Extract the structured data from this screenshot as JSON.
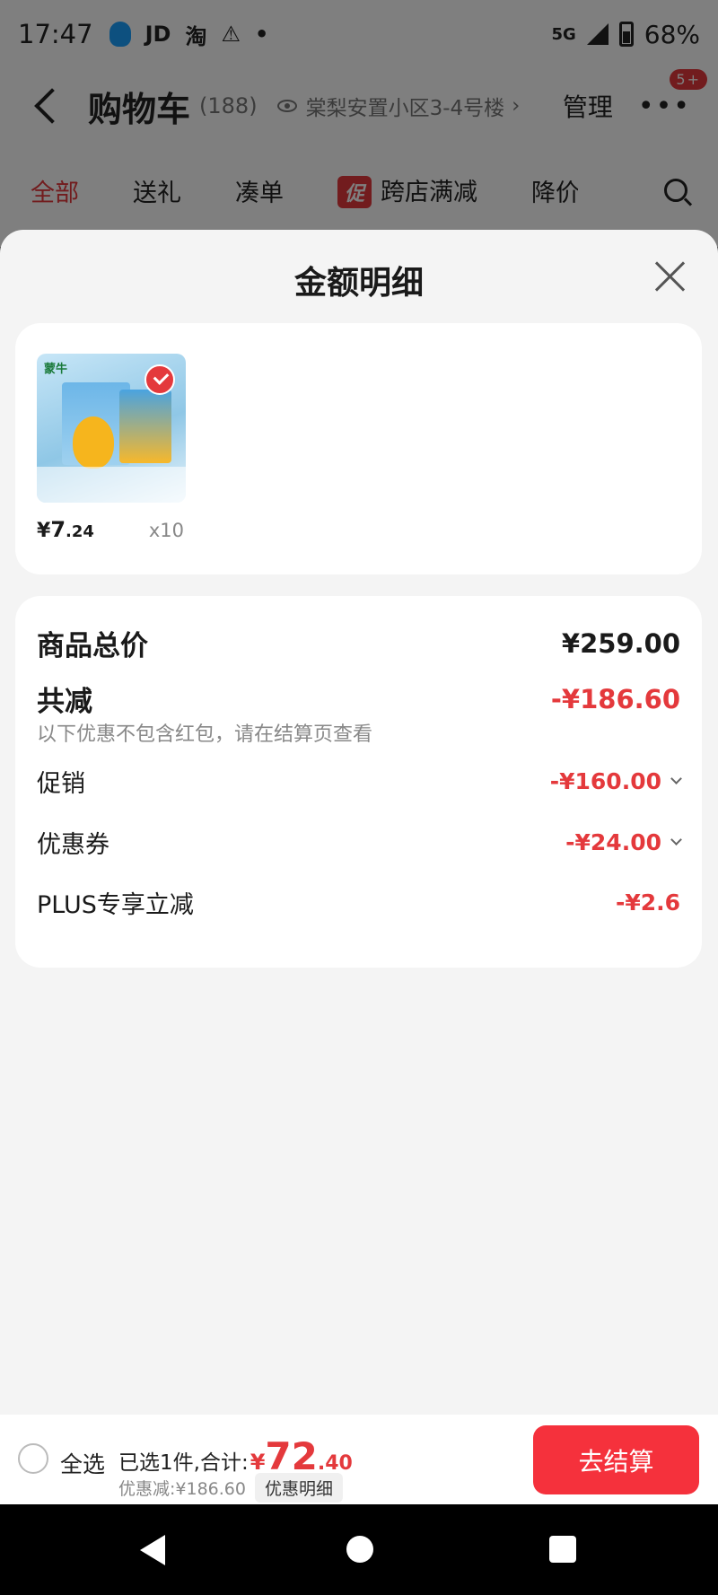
{
  "status_bar": {
    "time": "17:47",
    "app_icons": [
      "JD",
      "淘",
      "⚠",
      "•"
    ],
    "network": "5G",
    "battery": "68%"
  },
  "nav": {
    "title": "购物车",
    "count": "(188)",
    "address": "棠梨安置小区3-4号楼",
    "address_arrow": "›",
    "manage": "管理",
    "badge": "5+"
  },
  "tabs": [
    {
      "label": "全部",
      "active": true
    },
    {
      "label": "送礼"
    },
    {
      "label": "凑单"
    },
    {
      "label": "跨店满减",
      "tag": "促"
    },
    {
      "label": "降价"
    }
  ],
  "sheet": {
    "title": "金额明细",
    "product": {
      "brand": "蒙牛",
      "price_symbol": "¥",
      "price_int": "7",
      "price_dec": ".24",
      "quantity": "x10"
    },
    "summary": {
      "goods_total_label": "商品总价",
      "goods_total_value": "¥259.00",
      "discount_label": "共减",
      "discount_value": "-¥186.60",
      "discount_note": "以下优惠不包含红包，请在结算页查看",
      "items": [
        {
          "label": "促销",
          "value": "-¥160.00",
          "expandable": true
        },
        {
          "label": "优惠券",
          "value": "-¥24.00",
          "expandable": true
        },
        {
          "label": "PLUS专享立减",
          "value": "-¥2.6",
          "expandable": false
        }
      ]
    }
  },
  "bottom_bar": {
    "select_all": "全选",
    "selected_text": "已选1件,合计:",
    "total_symbol": "¥",
    "total_int": "72",
    "total_dec": ".40",
    "discount_text": "优惠减:¥186.60",
    "detail_chip": "优惠明细",
    "checkout": "去结算"
  },
  "colors": {
    "accent": "#e4393c",
    "checkout": "#f5313c",
    "sheet_bg": "#f4f4f4"
  }
}
